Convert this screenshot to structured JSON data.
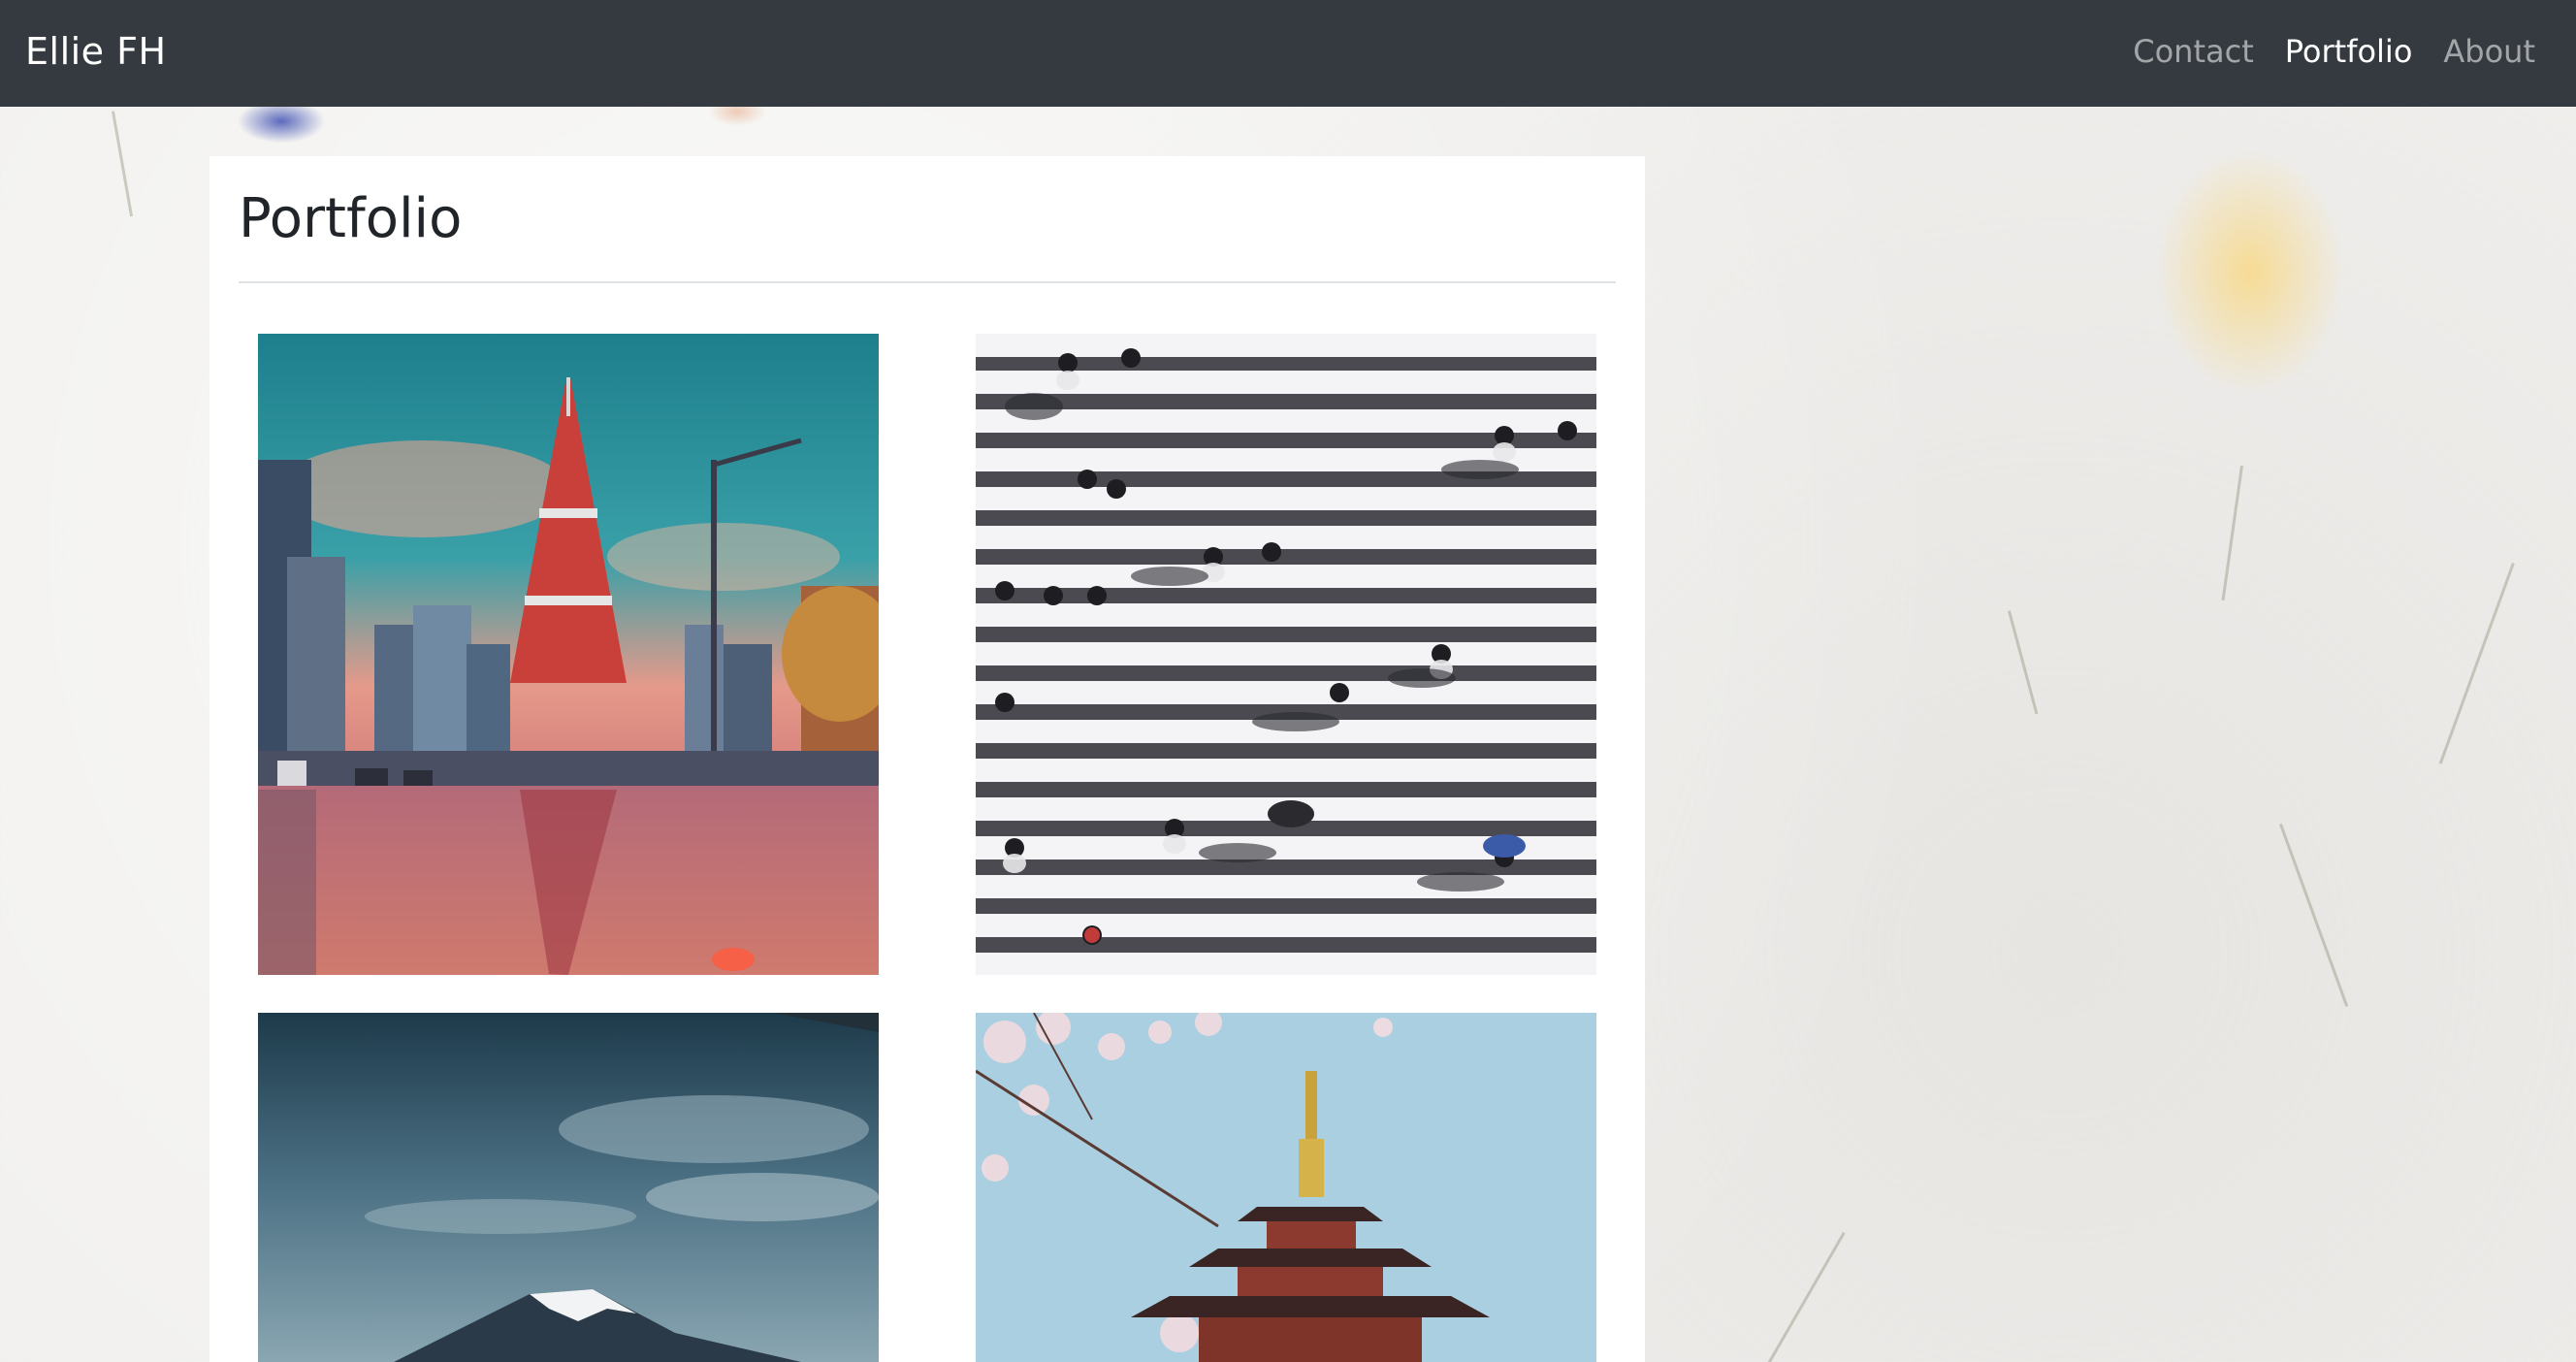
{
  "navbar": {
    "brand": "Ellie FH",
    "links": [
      {
        "label": "Contact",
        "active": false
      },
      {
        "label": "Portfolio",
        "active": true
      },
      {
        "label": "About",
        "active": false
      }
    ]
  },
  "page": {
    "title": "Portfolio"
  },
  "gallery": [
    {
      "subject": "tokyo-tower-reflection"
    },
    {
      "subject": "pedestrian-crosswalk-aerial"
    },
    {
      "subject": "mount-fuji-sky"
    },
    {
      "subject": "pagoda-cherry-blossoms"
    }
  ],
  "colors": {
    "navbar_bg": "#343a40",
    "nav_active": "#ffffff",
    "nav_inactive": "rgba(255,255,255,0.55)",
    "card_bg": "#ffffff",
    "title_text": "#212529"
  }
}
